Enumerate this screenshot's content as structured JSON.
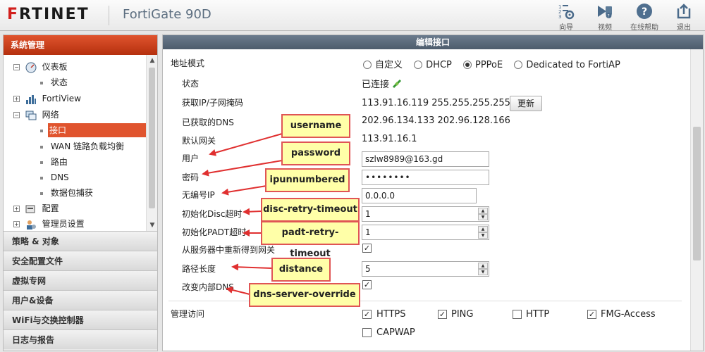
{
  "header": {
    "logo_prefix": "F",
    "logo_rest": "RTINET",
    "device_name": "FortiGate 90D",
    "toolbar": [
      {
        "label": "向导",
        "icon": "wizard-icon"
      },
      {
        "label": "视频",
        "icon": "video-icon"
      },
      {
        "label": "在线帮助",
        "icon": "help-icon"
      },
      {
        "label": "退出",
        "icon": "logout-icon"
      }
    ]
  },
  "sidebar": {
    "active_section": "系统管理",
    "tree": [
      {
        "label": "仪表板",
        "icon": "dashboard-icon",
        "expander": "−"
      },
      {
        "label": "状态"
      },
      {
        "label": "FortiView",
        "icon": "fortiview-icon",
        "expander": "+"
      },
      {
        "label": "网络",
        "icon": "network-icon",
        "expander": "−"
      },
      {
        "label": "接口",
        "selected": true
      },
      {
        "label": "WAN 链路负载均衡"
      },
      {
        "label": "路由"
      },
      {
        "label": "DNS"
      },
      {
        "label": "数据包捕获"
      },
      {
        "label": "配置",
        "icon": "config-icon",
        "expander": "+"
      },
      {
        "label": "管理员设置",
        "icon": "admin-icon",
        "expander": "+"
      }
    ],
    "sections": [
      "策略 & 对象",
      "安全配置文件",
      "虚拟专网",
      "用户&设备",
      "WiFi与交换控制器",
      "日志与报告"
    ]
  },
  "panel": {
    "title": "编辑接口",
    "address_mode": {
      "label": "地址模式",
      "options": [
        "自定义",
        "DHCP",
        "PPPoE",
        "Dedicated to FortiAP"
      ],
      "selected": "PPPoE"
    },
    "status": {
      "label": "状态",
      "value": "已连接"
    },
    "ip_mask": {
      "label": "获取IP/子网掩码",
      "value": "113.91.16.119 255.255.255.255",
      "button": "更新"
    },
    "dns": {
      "label": "已获取的DNS",
      "value": "202.96.134.133 202.96.128.166"
    },
    "gateway": {
      "label": "默认网关",
      "value": "113.91.16.1"
    },
    "username": {
      "label": "用户",
      "value": "szlw8989@163.gd"
    },
    "password": {
      "label": "密码",
      "value": "••••••••"
    },
    "unnumbered": {
      "label": "无编号IP",
      "value": "0.0.0.0"
    },
    "disc_timeout": {
      "label": "初始化Disc超时",
      "value": "1"
    },
    "padt_timeout": {
      "label": "初始化PADT超时",
      "value": "1"
    },
    "retrieve_gateway": {
      "label": "从服务器中重新得到网关",
      "checked": true
    },
    "distance": {
      "label": "路径长度",
      "value": "5"
    },
    "dns_override": {
      "label": "改变内部DNS",
      "checked": true
    },
    "admin_access": {
      "label": "管理访问",
      "options": [
        {
          "label": "HTTPS",
          "checked": true
        },
        {
          "label": "PING",
          "checked": true
        },
        {
          "label": "HTTP",
          "checked": false
        },
        {
          "label": "FMG-Access",
          "checked": true
        },
        {
          "label": "CAPWAP",
          "checked": false
        }
      ]
    }
  },
  "callouts": [
    "username",
    "password",
    "ipunnumbered",
    "disc-retry-timeout",
    "padt-retry-timeout",
    "distance",
    "dns-server-override"
  ],
  "colors": {
    "brand_red": "#d2201d",
    "callout_fill": "#ffffa8",
    "arrow": "#e03030"
  }
}
